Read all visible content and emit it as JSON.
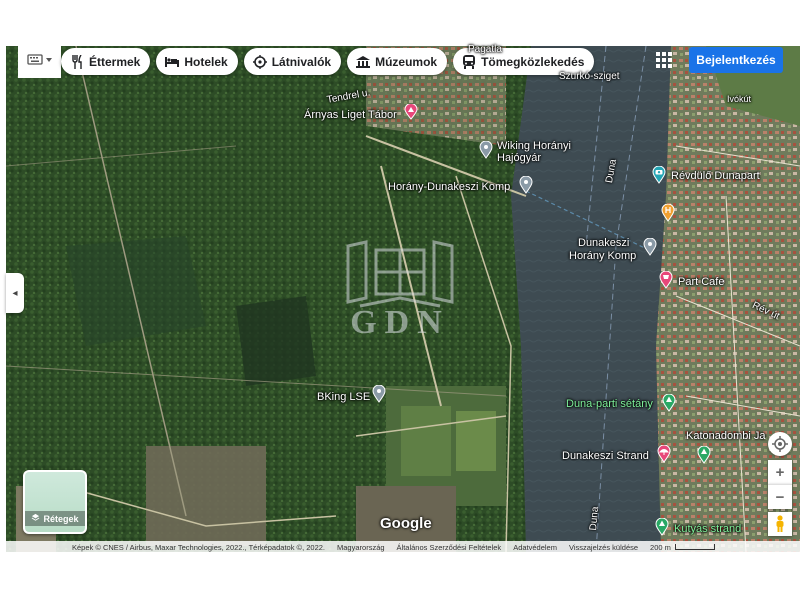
{
  "toolbar": {
    "keyboard_icon": "keyboard-icon",
    "chips": [
      {
        "label": "Éttermek",
        "icon": "restaurant-icon"
      },
      {
        "label": "Hotelek",
        "icon": "hotel-icon"
      },
      {
        "label": "Látnivalók",
        "icon": "attraction-icon"
      },
      {
        "label": "Múzeumok",
        "icon": "museum-icon"
      },
      {
        "label": "Tömegközlekedés",
        "icon": "transit-icon"
      }
    ],
    "apps_icon": "apps-grid-icon",
    "login_label": "Bejelentkezés",
    "login_color": "#1a73e8"
  },
  "places": {
    "arnyas": "Árnyas Liget Tábor",
    "wiking_1": "Wiking Horányi",
    "wiking_2": "Hajógyár",
    "horany_komp": "Horány-Dunakeszi Komp",
    "revdulo": "Révdülő Dunapart",
    "dunakeszi_komp_1": "Dunakeszi",
    "dunakeszi_komp_2": "Horány Komp",
    "part_cafe": "Part Cafe",
    "bking": "BKing LSE",
    "duna_setany": "Duna-parti sétány",
    "strand": "Dunakeszi Strand",
    "kutyas": "Kutyás strand",
    "katonadomb": "Katonadombi Ja",
    "szurko": "Szurkó-sziget",
    "duna_1": "Duna",
    "duna_2": "Duna",
    "rev_ut": "Rév út",
    "tendrel": "Tendrel u.",
    "ivokut": "Ivókút",
    "top_cut": "Pagatla"
  },
  "watermark": {
    "text": "GDN"
  },
  "layers": {
    "label": "Rétegek"
  },
  "branding": {
    "google": "Google"
  },
  "footer": {
    "imagery": "Képek © CNES / Airbus, Maxar Technologies, 2022., Térképadatok ©, 2022.",
    "country": "Magyarország",
    "terms": "Általános Szerződési Feltételek",
    "privacy": "Adatvédelem",
    "feedback": "Visszajelzés küldése",
    "scale": "200 m"
  },
  "controls": {
    "zoom_in": "+",
    "zoom_out": "−",
    "collapse": "◂"
  },
  "colors": {
    "forest": "#2f4f27",
    "river": "#3e4a50",
    "pin_pink": "#e8477a",
    "pin_gray": "#8a9aa6",
    "pin_green": "#2aa865",
    "pin_teal": "#24a6b5",
    "pin_orange": "#f0a030"
  }
}
